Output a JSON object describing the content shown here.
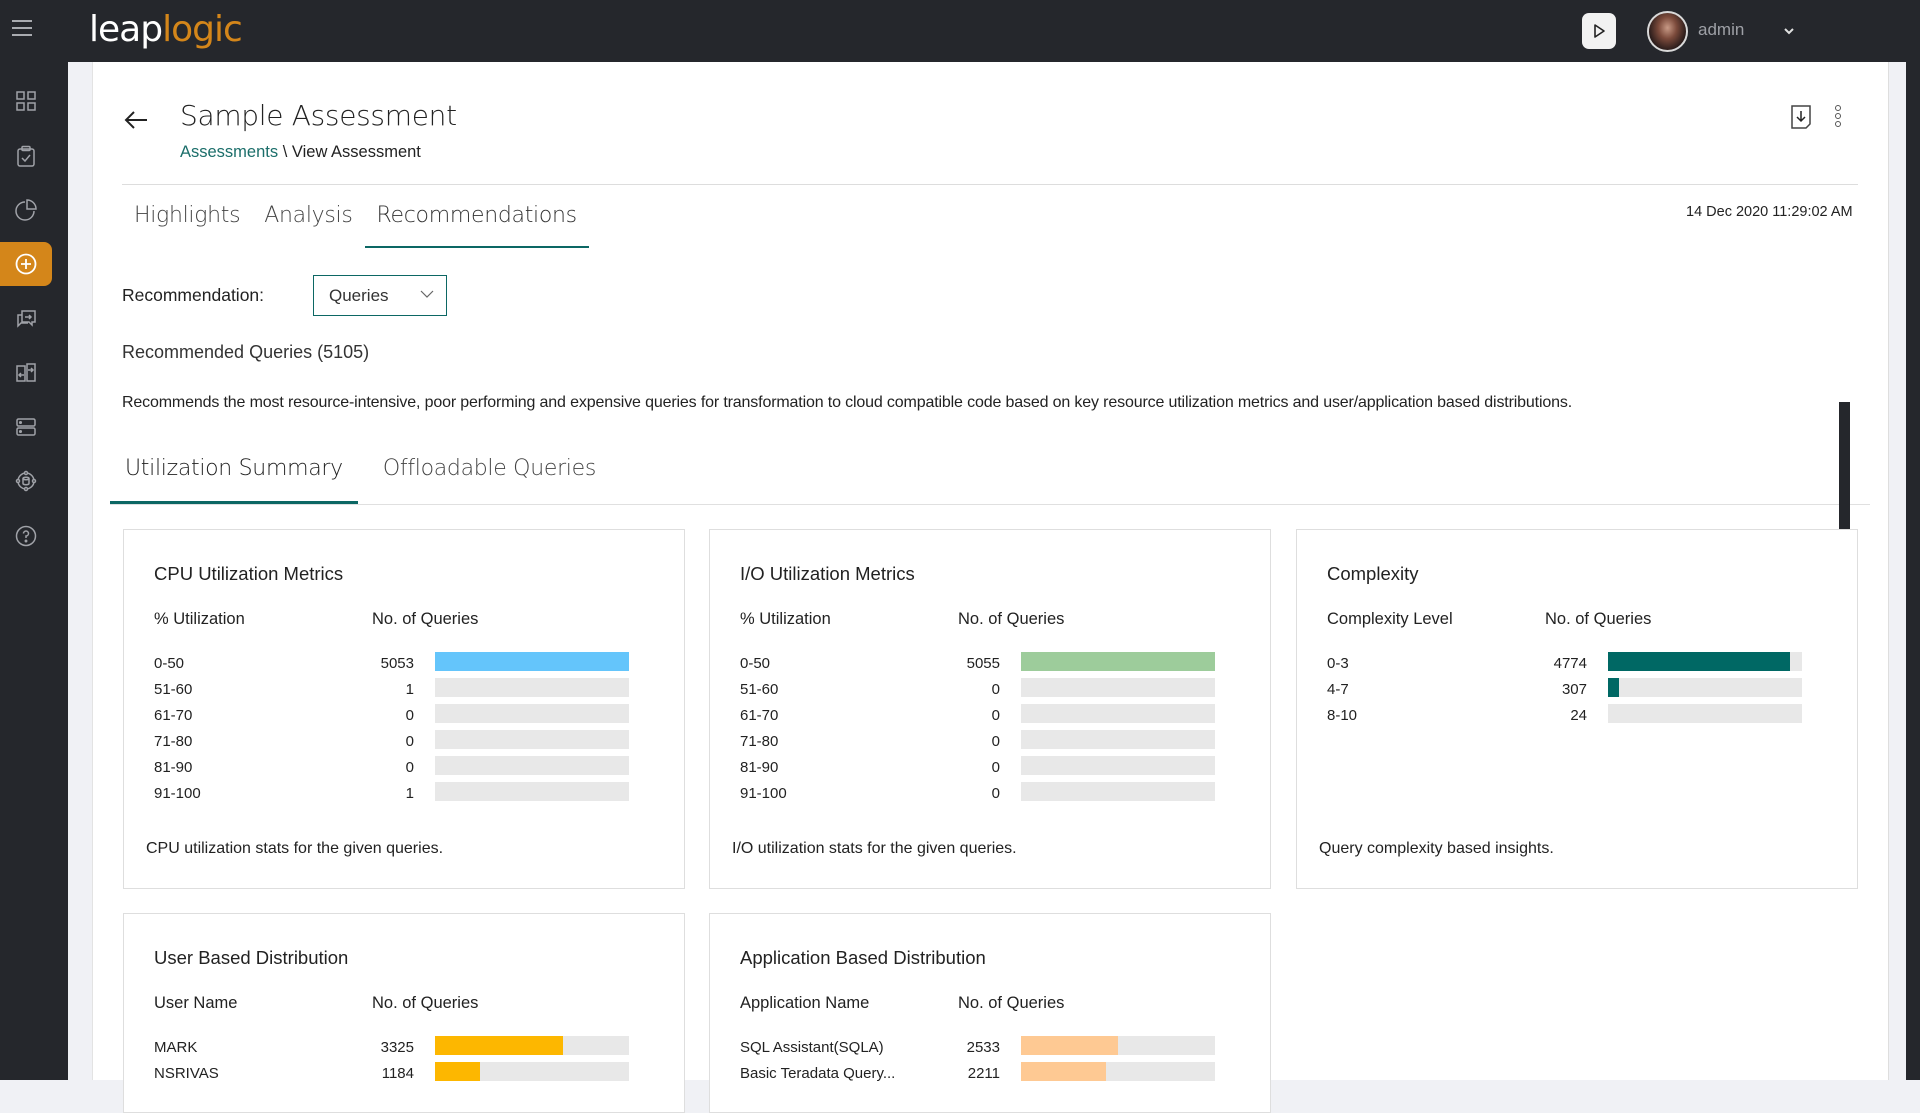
{
  "app": {
    "logo_part1": "leap",
    "logo_part2": "logic",
    "brand_color": "#d4861a",
    "accent_color": "#0c6764"
  },
  "topbar": {
    "user_name": "admin",
    "icons": [
      "menu-icon",
      "play-icon",
      "avatar",
      "chevron-down-icon"
    ]
  },
  "sidebar": {
    "items": [
      {
        "name": "dashboard",
        "icon": "grid-icon",
        "active": false
      },
      {
        "name": "assessments",
        "icon": "clipboard-check-icon",
        "active": false
      },
      {
        "name": "analytics",
        "icon": "pie-chart-icon",
        "active": false
      },
      {
        "name": "add",
        "icon": "plus-circle-icon",
        "active": true
      },
      {
        "name": "transform",
        "icon": "chat-transfer-icon",
        "active": false
      },
      {
        "name": "compare",
        "icon": "compare-arrows-icon",
        "active": false
      },
      {
        "name": "storage",
        "icon": "server-icon",
        "active": false
      },
      {
        "name": "data-network",
        "icon": "database-network-icon",
        "active": false
      },
      {
        "name": "help",
        "icon": "help-circle-icon",
        "active": false
      }
    ]
  },
  "header": {
    "title": "Sample Assessment",
    "breadcrumb_link": "Assessments",
    "breadcrumb_sep": " \\ ",
    "breadcrumb_current": "View Assessment",
    "timestamp": "14 Dec 2020 11:29:02 AM"
  },
  "tabs": [
    {
      "label": "Highlights",
      "active": false
    },
    {
      "label": "Analysis",
      "active": false
    },
    {
      "label": "Recommendations",
      "active": true
    }
  ],
  "recommendation": {
    "label": "Recommendation:",
    "selected": "Queries",
    "count_text": "Recommended Queries (5105)",
    "description": "Recommends the most resource-intensive, poor performing and expensive queries for transformation to cloud compatible code based on key resource utilization metrics and user/application based distributions."
  },
  "sub_tabs": [
    {
      "label": "Utilization Summary",
      "active": true
    },
    {
      "label": "Offloadable Queries",
      "active": false
    }
  ],
  "cards": {
    "cpu": {
      "title": "CPU Utilization Metrics",
      "col1": "% Utilization",
      "col2": "No. of Queries",
      "color": "#64c5fb",
      "footer": "CPU utilization stats for the given queries.",
      "rows": [
        {
          "label": "0-50",
          "value": "5053",
          "fraction": 1.0
        },
        {
          "label": "51-60",
          "value": "1",
          "fraction": 0.0002
        },
        {
          "label": "61-70",
          "value": "0",
          "fraction": 0
        },
        {
          "label": "71-80",
          "value": "0",
          "fraction": 0
        },
        {
          "label": "81-90",
          "value": "0",
          "fraction": 0
        },
        {
          "label": "91-100",
          "value": "1",
          "fraction": 0.0002
        }
      ]
    },
    "io": {
      "title": "I/O Utilization Metrics",
      "col1": "% Utilization",
      "col2": "No. of Queries",
      "color": "#9dcc9b",
      "footer": "I/O utilization stats for the given queries.",
      "rows": [
        {
          "label": "0-50",
          "value": "5055",
          "fraction": 1.0
        },
        {
          "label": "51-60",
          "value": "0",
          "fraction": 0
        },
        {
          "label": "61-70",
          "value": "0",
          "fraction": 0
        },
        {
          "label": "71-80",
          "value": "0",
          "fraction": 0
        },
        {
          "label": "81-90",
          "value": "0",
          "fraction": 0
        },
        {
          "label": "91-100",
          "value": "0",
          "fraction": 0
        }
      ]
    },
    "complexity": {
      "title": "Complexity",
      "col1": "Complexity Level",
      "col2": "No. of Queries",
      "color": "#006864",
      "footer": "Query complexity based insights.",
      "rows": [
        {
          "label": "0-3",
          "value": "4774",
          "fraction": 0.94
        },
        {
          "label": "4-7",
          "value": "307",
          "fraction": 0.056
        },
        {
          "label": "8-10",
          "value": "24",
          "fraction": 0
        }
      ]
    },
    "user": {
      "title": "User Based Distribution",
      "col1": "User Name",
      "col2": "No. of Queries",
      "color": "#fdb700",
      "rows": [
        {
          "label": "MARK",
          "value": "3325",
          "fraction": 0.66
        },
        {
          "label": "NSRIVAS",
          "value": "1184",
          "fraction": 0.23
        }
      ]
    },
    "application": {
      "title": "Application Based Distribution",
      "col1": "Application Name",
      "col2": "No. of Queries",
      "color": "#fec993",
      "rows": [
        {
          "label": "SQL Assistant(SQLA)",
          "value": "2533",
          "fraction": 0.5
        },
        {
          "label": "Basic Teradata Query...",
          "value": "2211",
          "fraction": 0.44
        }
      ]
    }
  }
}
